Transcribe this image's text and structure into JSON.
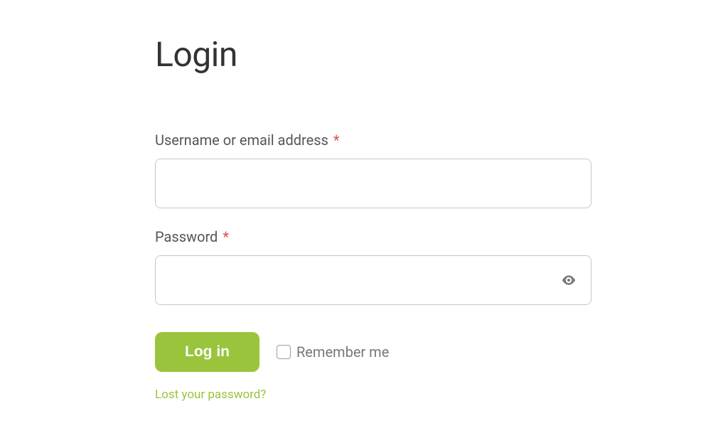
{
  "title": "Login",
  "fields": {
    "username": {
      "label": "Username or email address",
      "required_mark": "*",
      "value": ""
    },
    "password": {
      "label": "Password",
      "required_mark": "*",
      "value": ""
    }
  },
  "actions": {
    "submit_label": "Log in",
    "remember_label": "Remember me",
    "lost_password_label": "Lost your password?"
  }
}
